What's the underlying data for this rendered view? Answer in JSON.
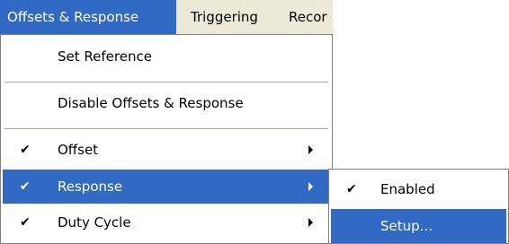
{
  "menubar": {
    "items": [
      {
        "label": "Offsets & Response"
      },
      {
        "label": "Triggering"
      },
      {
        "label": "Recor"
      }
    ]
  },
  "menu": {
    "items": [
      {
        "label": "Set Reference",
        "checked": false,
        "has_submenu": false
      },
      {
        "label": "Disable Offsets & Response",
        "checked": false,
        "has_submenu": false
      },
      {
        "label": "Offset",
        "checked": true,
        "has_submenu": true
      },
      {
        "label": "Response",
        "checked": true,
        "has_submenu": true,
        "highlighted": true
      },
      {
        "label": "Duty Cycle",
        "checked": true,
        "has_submenu": true
      }
    ],
    "check_glyph": "✔"
  },
  "submenu": {
    "items": [
      {
        "label": "Enabled",
        "checked": true
      },
      {
        "label": "Setup...",
        "checked": false,
        "highlighted": true
      }
    ]
  },
  "colors": {
    "highlight": "#316ac5",
    "menubar_bg": "#ece9d8",
    "menu_border": "#808080"
  }
}
